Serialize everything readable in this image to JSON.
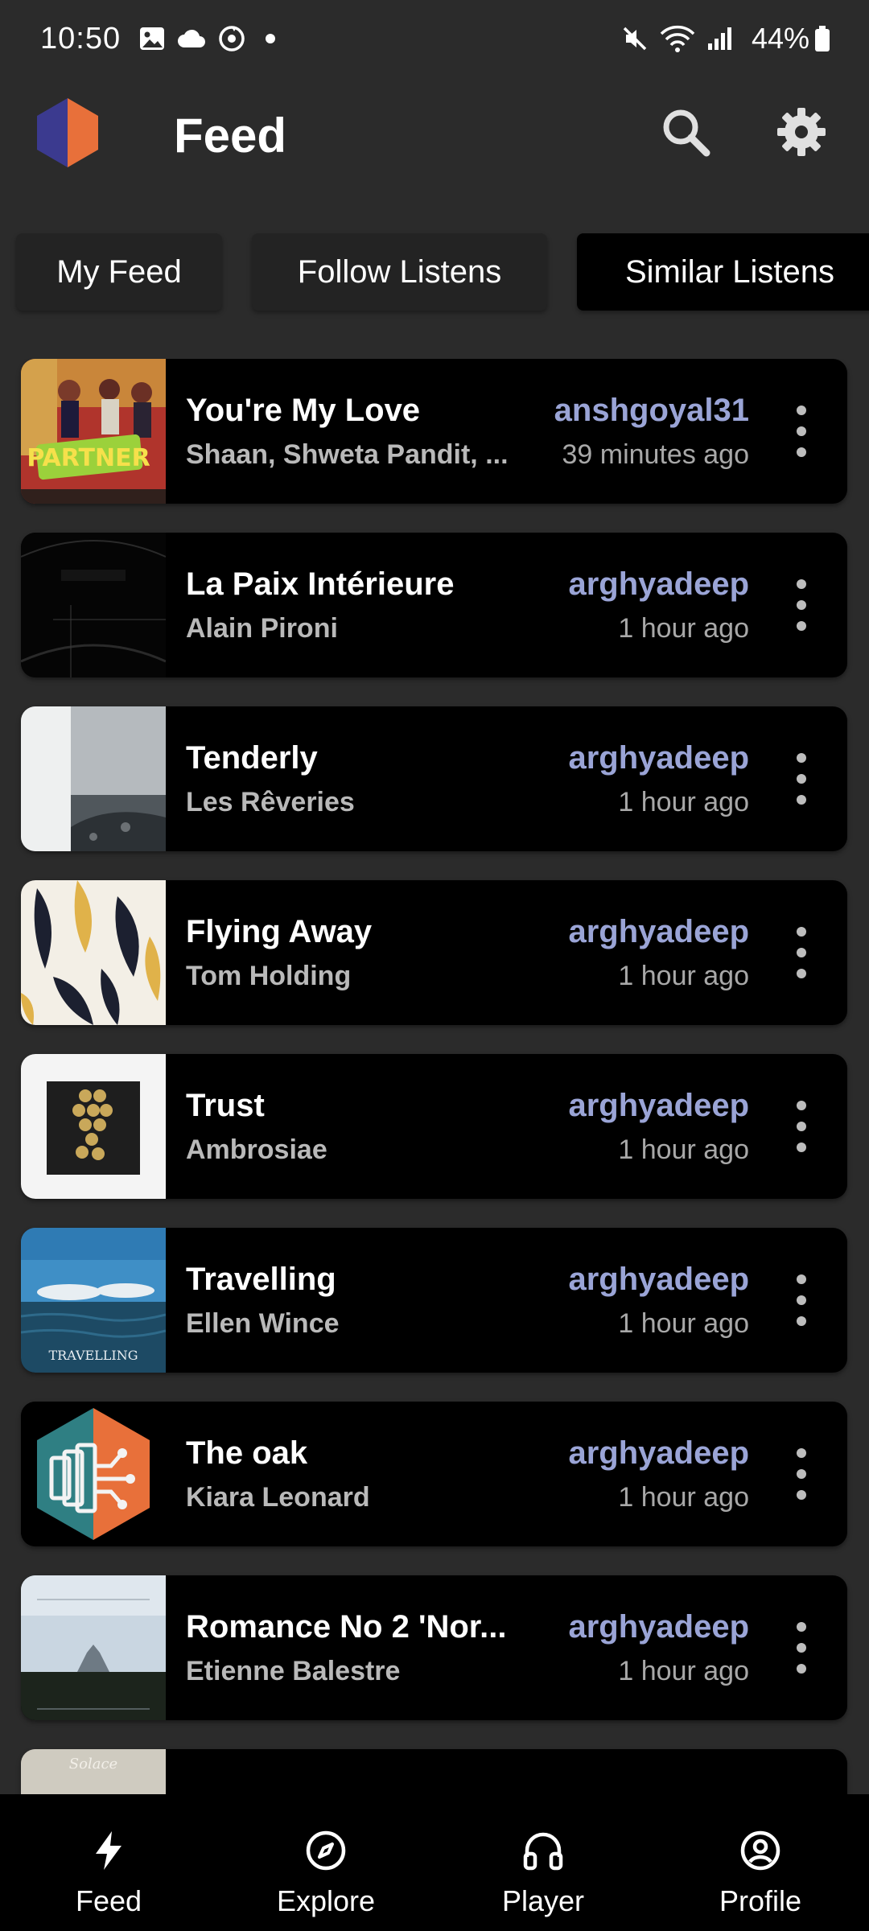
{
  "status_bar": {
    "time": "10:50",
    "battery": "44%",
    "icons": [
      "gallery-icon",
      "cloud-icon",
      "sync-icon",
      "mute-icon",
      "wifi-icon",
      "signal-icon",
      "battery-icon"
    ]
  },
  "app_bar": {
    "title": "Feed",
    "logo": "listenbrainz-logo",
    "actions": [
      "search-icon",
      "gear-icon"
    ]
  },
  "tabs": [
    {
      "label": "My Feed",
      "active": false
    },
    {
      "label": "Follow Listens",
      "active": false
    },
    {
      "label": "Similar Listens",
      "active": true
    }
  ],
  "feed": [
    {
      "title": "You're My Love",
      "artist": "Shaan, Shweta Pandit, ...",
      "user": "anshgoyal31",
      "time": "39 minutes ago"
    },
    {
      "title": "La Paix Intérieure",
      "artist": "Alain Pironi",
      "user": "arghyadeep",
      "time": "1 hour ago"
    },
    {
      "title": "Tenderly",
      "artist": "Les Rêveries",
      "user": "arghyadeep",
      "time": "1 hour ago"
    },
    {
      "title": "Flying Away",
      "artist": "Tom Holding",
      "user": "arghyadeep",
      "time": "1 hour ago"
    },
    {
      "title": "Trust",
      "artist": "Ambrosiae",
      "user": "arghyadeep",
      "time": "1 hour ago"
    },
    {
      "title": "Travelling",
      "artist": "Ellen Wince",
      "user": "arghyadeep",
      "time": "1 hour ago"
    },
    {
      "title": "The oak",
      "artist": "Kiara Leonard",
      "user": "arghyadeep",
      "time": "1 hour ago"
    },
    {
      "title": "Romance No 2 'Nor...",
      "artist": "Etienne Balestre",
      "user": "arghyadeep",
      "time": "1 hour ago"
    },
    {
      "title": "",
      "artist": "",
      "user": "",
      "time": ""
    }
  ],
  "album_art_text": {
    "partner": "PARTNER",
    "travelling": "TRAVELLING",
    "solace": "Solace"
  },
  "bottom_nav": [
    {
      "label": "Feed",
      "icon": "bolt-icon"
    },
    {
      "label": "Explore",
      "icon": "compass-icon"
    },
    {
      "label": "Player",
      "icon": "headphones-icon"
    },
    {
      "label": "Profile",
      "icon": "profile-icon"
    }
  ],
  "colors": {
    "background": "#2b2b2b",
    "card": "#000000",
    "username": "#9aa4d6",
    "secondary_text": "#b9b9b9",
    "logo_orange": "#e8703a",
    "logo_purple": "#3b3a8f"
  }
}
